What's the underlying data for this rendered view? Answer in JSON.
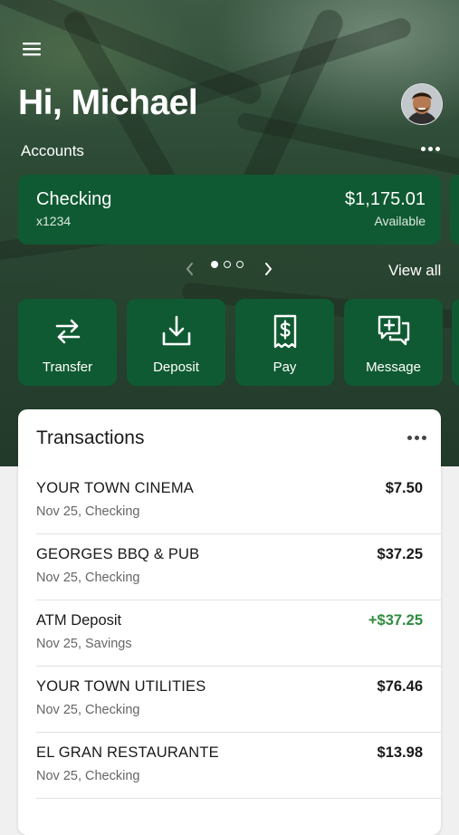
{
  "header": {
    "greeting": "Hi, Michael",
    "menu_icon": "hamburger-menu-icon",
    "avatar_icon": "user-avatar"
  },
  "accounts": {
    "section_label": "Accounts",
    "more_icon": "more-horizontal-icon",
    "cards": [
      {
        "name": "Checking",
        "number": "x1234",
        "balance": "$1,175.01",
        "balance_label": "Available"
      }
    ],
    "pager": {
      "total_pages": 3,
      "current_page": 1
    },
    "view_all_label": "View all"
  },
  "actions": [
    {
      "label": "Transfer",
      "icon": "transfer-arrows-icon"
    },
    {
      "label": "Deposit",
      "icon": "download-tray-icon"
    },
    {
      "label": "Pay",
      "icon": "dollar-receipt-icon"
    },
    {
      "label": "Message",
      "icon": "chat-plus-icon"
    }
  ],
  "transactions": {
    "title": "Transactions",
    "more_icon": "more-horizontal-icon",
    "items": [
      {
        "merchant": "YOUR TOWN CINEMA",
        "meta": "Nov 25, Checking",
        "amount": "$7.50",
        "type": "debit"
      },
      {
        "merchant": "GEORGES BBQ & PUB",
        "meta": "Nov 25, Checking",
        "amount": "$37.25",
        "type": "debit"
      },
      {
        "merchant": "ATM Deposit",
        "meta": "Nov 25, Savings",
        "amount": "+$37.25",
        "type": "credit"
      },
      {
        "merchant": "YOUR TOWN UTILITIES",
        "meta": "Nov 25, Checking",
        "amount": "$76.46",
        "type": "debit"
      },
      {
        "merchant": "EL GRAN RESTAURANTE",
        "meta": "Nov 25, Checking",
        "amount": "$13.98",
        "type": "debit"
      }
    ]
  },
  "colors": {
    "brand_green": "#0f5a32",
    "credit_green": "#2e8b3e",
    "hero_dark": "#27402f"
  }
}
